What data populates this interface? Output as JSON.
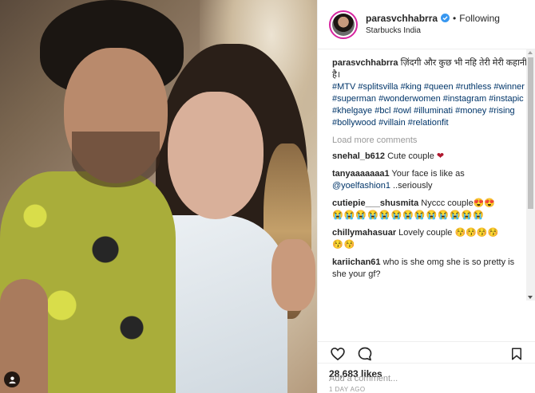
{
  "post": {
    "username": "parasvchhabrra",
    "follow_label": "Following",
    "separator": "•",
    "location": "Starbucks India",
    "caption_text": "ज़िंदगी और कुछ भी नहि तेरी मेरी कहानी है।",
    "hashtags": "#MTV #splitsvilla #king #queen #ruthless #winner #superman #wonderwomen #instagram #instapic #khelgaye #bcl #owl #illuminati #money #rising #bollywood #villain #relationfit",
    "load_more": "Load more comments",
    "likes": "28,683 likes",
    "time": "1 DAY AGO",
    "add_comment_placeholder": "Add a comment..."
  },
  "comments": [
    {
      "user": "snehal_b612",
      "text": "Cute couple",
      "suffix": "❤"
    },
    {
      "user": "tanyaaaaaaa1",
      "text": "Your face is like as",
      "mention": "@yoelfashion1",
      "after": " ..seriously"
    },
    {
      "user": "cutiepie___shusmita",
      "text": "Nyccc couple😍😍",
      "line2": "😭😭😭😭😭😭😭😭😭😭😭😭😭"
    },
    {
      "user": "chillymahasuar",
      "text": "Lovely couple 😚😚😚😚",
      "line2": "😚😚"
    },
    {
      "user": "kariichan61",
      "text": "who is she omg she is so pretty is she your gf?"
    }
  ],
  "icons": {
    "verified": "verified-badge-icon",
    "like": "heart-icon",
    "comment": "comment-bubble-icon",
    "save": "bookmark-icon",
    "user_tag": "user-tag-icon"
  },
  "colors": {
    "hashtag": "#003569",
    "verified": "#3897f0",
    "heart": "#b0182f",
    "muted": "#999999"
  }
}
